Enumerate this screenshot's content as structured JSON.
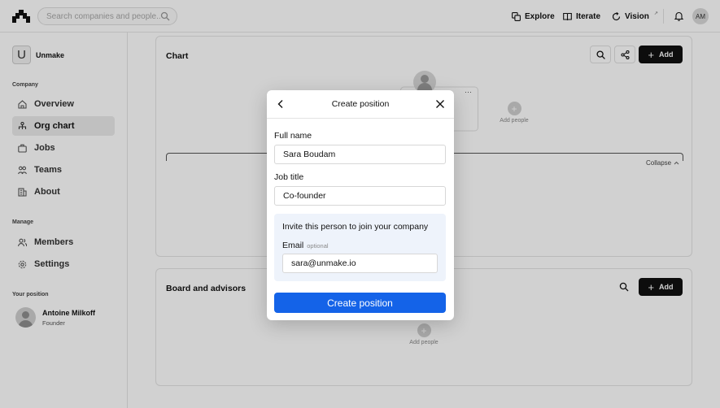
{
  "topbar": {
    "logo_icon": "unmake-logo-icon",
    "search_placeholder": "Search companies and people...",
    "nav": [
      {
        "label": "Explore",
        "icon": "explore-icon"
      },
      {
        "label": "Iterate",
        "icon": "book-icon"
      },
      {
        "label": "Vision",
        "icon": "refresh-icon",
        "badge": "↗"
      }
    ],
    "avatar_initials": "AM"
  },
  "sidebar": {
    "company_initial": "U",
    "company_name": "Unmake",
    "company_section": "Company",
    "company_items": [
      {
        "label": "Overview",
        "icon": "home-icon"
      },
      {
        "label": "Org chart",
        "icon": "org-chart-icon",
        "active": true
      },
      {
        "label": "Jobs",
        "icon": "briefcase-icon"
      },
      {
        "label": "Teams",
        "icon": "teams-icon"
      },
      {
        "label": "About",
        "icon": "building-icon"
      }
    ],
    "manage_section": "Manage",
    "manage_items": [
      {
        "label": "Members",
        "icon": "members-icon"
      },
      {
        "label": "Settings",
        "icon": "gear-icon"
      }
    ],
    "position_section": "Your position",
    "position_name": "Antoine Milkoff",
    "position_role": "Founder"
  },
  "chart_card": {
    "title": "Chart",
    "add_label": "Add",
    "add_people": "Add people",
    "collapse_label": "Collapse"
  },
  "board_card": {
    "title": "Board and advisors",
    "add_label": "Add",
    "add_people": "Add people"
  },
  "modal": {
    "title": "Create position",
    "full_name_label": "Full name",
    "full_name_value": "Sara Boudam",
    "job_title_label": "Job title",
    "job_title_value": "Co-founder",
    "invite_text": "Invite this person to join your company",
    "email_label": "Email",
    "email_optional": "optional",
    "email_value": "sara@unmake.io",
    "submit_label": "Create position"
  },
  "colors": {
    "primary": "#1463e8",
    "dark_button": "#111111",
    "invite_bg": "#eef3fb",
    "overlay": "rgba(0,0,0,0.18)"
  }
}
